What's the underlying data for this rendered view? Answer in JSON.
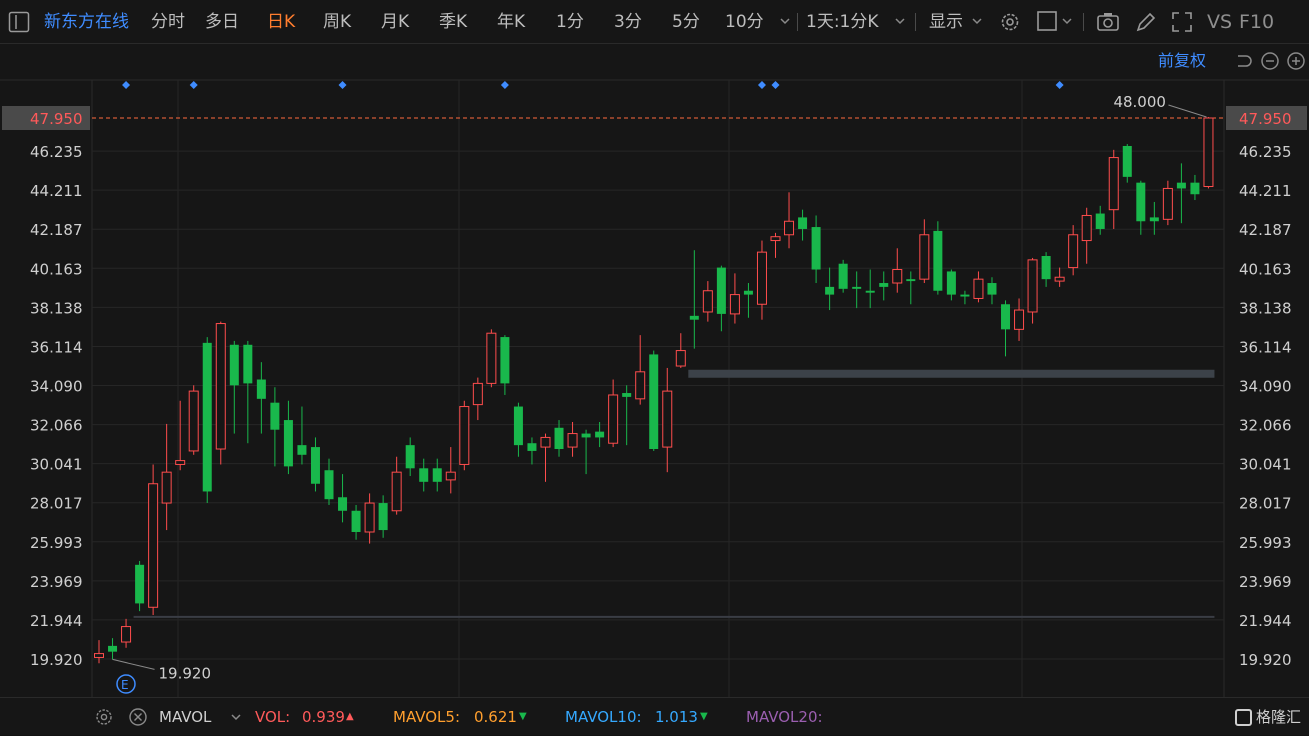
{
  "toolbar": {
    "stock_name": "新东方在线",
    "periods": [
      "分时",
      "多日",
      "日K",
      "周K",
      "月K",
      "季K",
      "年K",
      "1分",
      "3分",
      "5分",
      "10分"
    ],
    "selected_period": "日K",
    "dual_setting": "1天:1分K",
    "display_label": "显示",
    "vs_label": "VS",
    "f10_label": "F10"
  },
  "chart_header": {
    "adjust_label": "前复权"
  },
  "chart_data": {
    "type": "candlestick",
    "ylim": [
      18.9,
      49.0
    ],
    "y_ticks": [
      "47.950",
      "46.235",
      "44.211",
      "42.187",
      "40.163",
      "38.138",
      "36.114",
      "34.090",
      "32.066",
      "30.041",
      "28.017",
      "25.993",
      "23.969",
      "21.944",
      "19.920"
    ],
    "current_price": "47.950",
    "high_label": "48.000",
    "low_label": "19.920",
    "event_marker": "E",
    "colors": {
      "up": "#ff4d4d",
      "down": "#19b84c",
      "dash": "#ff6a3d",
      "bg": "#161616",
      "grid": "#262626"
    },
    "candles": [
      [
        20.0,
        20.2,
        20.9,
        19.7
      ],
      [
        20.6,
        20.3,
        21.0,
        19.9
      ],
      [
        20.8,
        21.6,
        22.0,
        20.5
      ],
      [
        24.8,
        22.8,
        25.0,
        22.4
      ],
      [
        22.6,
        29.0,
        30.0,
        22.2
      ],
      [
        28.0,
        29.6,
        32.1,
        26.6
      ],
      [
        30.0,
        30.2,
        33.3,
        29.7
      ],
      [
        30.7,
        33.8,
        34.1,
        30.5
      ],
      [
        36.3,
        28.6,
        36.6,
        28.0
      ],
      [
        30.8,
        37.3,
        37.4,
        30.0
      ],
      [
        36.2,
        34.1,
        36.4,
        31.6
      ],
      [
        36.2,
        34.2,
        36.4,
        31.1
      ],
      [
        34.4,
        33.4,
        35.3,
        31.6
      ],
      [
        33.2,
        31.8,
        34.0,
        29.9
      ],
      [
        32.3,
        29.9,
        33.3,
        29.5
      ],
      [
        31.0,
        30.5,
        33.0,
        30.0
      ],
      [
        30.9,
        29.0,
        31.4,
        28.6
      ],
      [
        29.7,
        28.2,
        30.3,
        27.9
      ],
      [
        28.3,
        27.6,
        29.5,
        27.0
      ],
      [
        27.6,
        26.5,
        27.9,
        26.1
      ],
      [
        26.5,
        28.0,
        28.5,
        25.9
      ],
      [
        28.0,
        26.6,
        28.4,
        26.2
      ],
      [
        27.6,
        29.6,
        30.4,
        27.4
      ],
      [
        31.0,
        29.8,
        31.4,
        29.4
      ],
      [
        29.8,
        29.1,
        30.3,
        28.6
      ],
      [
        29.8,
        29.1,
        30.3,
        28.6
      ],
      [
        29.2,
        29.6,
        30.9,
        28.5
      ],
      [
        30.0,
        33.0,
        33.3,
        29.7
      ],
      [
        33.1,
        34.2,
        34.5,
        32.3
      ],
      [
        34.2,
        36.8,
        37.0,
        34.0
      ],
      [
        36.6,
        34.2,
        36.7,
        33.6
      ],
      [
        33.0,
        31.0,
        33.2,
        30.4
      ],
      [
        31.1,
        30.7,
        31.4,
        30.0
      ],
      [
        30.9,
        31.4,
        31.6,
        29.1
      ],
      [
        31.9,
        30.8,
        32.3,
        30.4
      ],
      [
        30.9,
        31.6,
        32.2,
        30.4
      ],
      [
        31.6,
        31.4,
        31.8,
        29.5
      ],
      [
        31.7,
        31.4,
        32.2,
        30.9
      ],
      [
        31.1,
        33.6,
        34.4,
        30.9
      ],
      [
        33.7,
        33.5,
        34.1,
        31.0
      ],
      [
        33.4,
        34.8,
        36.7,
        33.1
      ],
      [
        35.7,
        30.8,
        35.9,
        30.7
      ],
      [
        30.9,
        33.8,
        35.0,
        29.6
      ],
      [
        35.1,
        35.9,
        36.8,
        35.0
      ],
      [
        37.7,
        37.5,
        41.1,
        36.0
      ],
      [
        37.9,
        39.0,
        39.5,
        37.4
      ],
      [
        40.2,
        37.8,
        40.3,
        36.9
      ],
      [
        37.8,
        38.8,
        39.9,
        37.3
      ],
      [
        39.0,
        38.8,
        39.4,
        37.6
      ],
      [
        38.3,
        41.0,
        41.6,
        37.5
      ],
      [
        41.6,
        41.8,
        42.0,
        40.7
      ],
      [
        41.9,
        42.6,
        44.1,
        41.2
      ],
      [
        42.8,
        42.2,
        43.2,
        41.6
      ],
      [
        42.3,
        40.1,
        42.9,
        39.4
      ],
      [
        39.2,
        38.8,
        40.2,
        38.0
      ],
      [
        40.4,
        39.1,
        40.6,
        38.9
      ],
      [
        39.2,
        39.1,
        40.0,
        38.1
      ],
      [
        39.0,
        38.9,
        40.1,
        38.1
      ],
      [
        39.4,
        39.2,
        40.0,
        38.5
      ],
      [
        39.4,
        40.1,
        41.2,
        38.9
      ],
      [
        39.6,
        39.5,
        40.0,
        38.3
      ],
      [
        39.6,
        41.9,
        42.7,
        39.4
      ],
      [
        42.1,
        39.0,
        42.6,
        38.8
      ],
      [
        40.0,
        38.8,
        40.1,
        38.5
      ],
      [
        38.8,
        38.7,
        39.0,
        38.3
      ],
      [
        38.6,
        39.6,
        40.0,
        38.4
      ],
      [
        39.4,
        38.8,
        39.7,
        38.3
      ],
      [
        38.3,
        37.0,
        38.5,
        35.6
      ],
      [
        37.0,
        38.0,
        38.6,
        36.4
      ],
      [
        37.9,
        40.6,
        40.7,
        37.3
      ],
      [
        40.8,
        39.6,
        41.0,
        39.2
      ],
      [
        39.5,
        39.7,
        40.2,
        39.2
      ],
      [
        40.2,
        41.9,
        42.4,
        39.8
      ],
      [
        41.6,
        42.9,
        43.3,
        40.4
      ],
      [
        43.0,
        42.2,
        43.4,
        41.9
      ],
      [
        43.2,
        45.9,
        46.3,
        42.2
      ],
      [
        46.5,
        44.9,
        46.6,
        44.6
      ],
      [
        44.6,
        42.6,
        44.7,
        41.9
      ],
      [
        42.8,
        42.6,
        43.6,
        41.9
      ],
      [
        42.7,
        44.3,
        44.7,
        42.4
      ],
      [
        44.6,
        44.3,
        45.6,
        42.5
      ],
      [
        44.6,
        44.0,
        45.0,
        43.7
      ],
      [
        44.4,
        47.95,
        48.0,
        44.3
      ]
    ],
    "support_lines": [
      {
        "value": 34.7,
        "from": 44,
        "to": 82
      },
      {
        "value": 22.1,
        "from": 3,
        "to": 82
      }
    ],
    "event_dots": [
      2,
      7,
      18,
      30,
      49,
      50,
      71
    ]
  },
  "bottom": {
    "indicator": "MAVOL",
    "vol_label": "VOL:",
    "vol_value": "0.939",
    "mavol5_label": "MAVOL5:",
    "mavol5_value": "0.621",
    "mavol10_label": "MAVOL10:",
    "mavol10_value": "1.013",
    "mavol20_label": "MAVOL20:",
    "colors": {
      "vol": "#ff5a5a",
      "mavol5": "#ff9f2e",
      "mavol10": "#35a9ff",
      "mavol20": "#9b5fb0"
    },
    "brand": "格隆汇"
  }
}
